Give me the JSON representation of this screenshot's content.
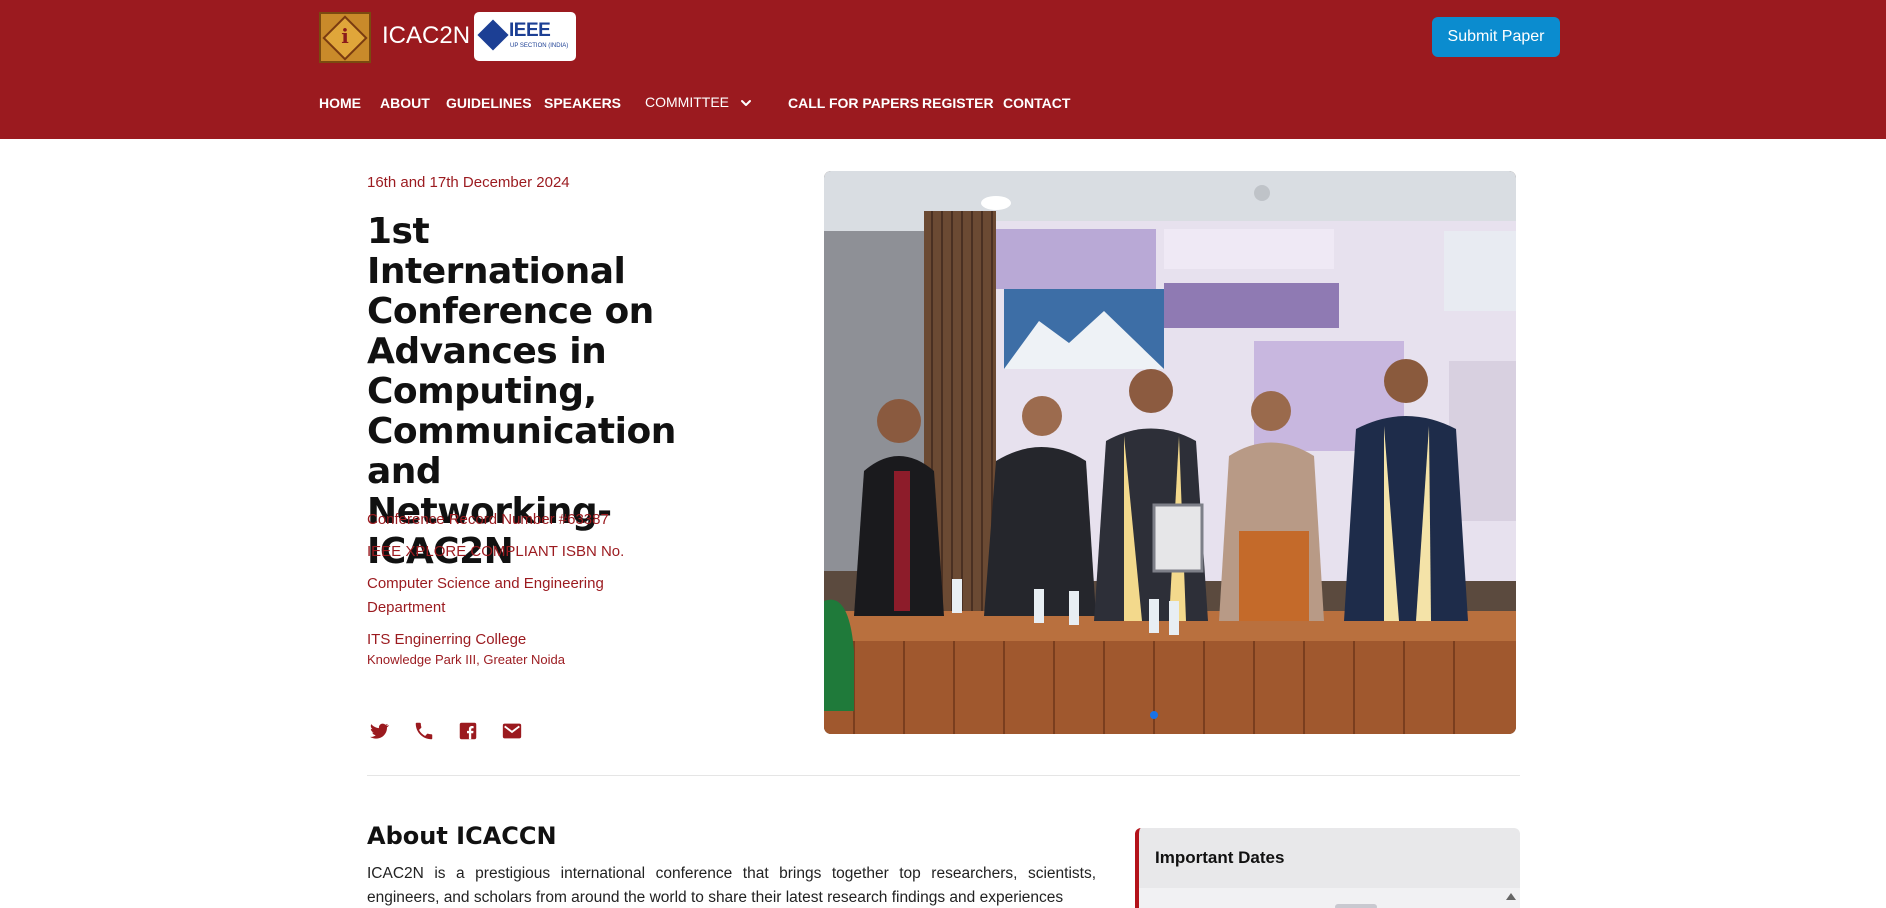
{
  "header": {
    "brand": "ICAC2N",
    "ieee_logo": {
      "text": "IEEE",
      "subtext": "UP SECTION (INDIA)"
    },
    "submit_label": "Submit Paper"
  },
  "nav": {
    "items": [
      {
        "label": "HOME"
      },
      {
        "label": "ABOUT"
      },
      {
        "label": "GUIDELINES"
      },
      {
        "label": "SPEAKERS"
      },
      {
        "label": "COMMITTEE"
      },
      {
        "label": "CALL FOR PAPERS"
      },
      {
        "label": "REGISTER"
      },
      {
        "label": "CONTACT"
      }
    ]
  },
  "hero": {
    "date": "16th and 17th December 2024",
    "title": "1st International Conference on Advances in Computing, Communication and Networking-ICAC2N",
    "record": "Conference Record Number #63387",
    "isbn": "IEEE XPLORE COMPLIANT ISBN No.",
    "department": "Computer Science and Engineering Department",
    "college": "ITS Enginerring College",
    "location": "Knowledge Park III, Greater Noida",
    "social_icons": [
      "twitter-icon",
      "phone-icon",
      "facebook-icon",
      "mail-icon"
    ]
  },
  "about": {
    "title": "About ICACCN",
    "text": "ICAC2N is a prestigious international conference that brings together top researchers, scientists, engineers, and scholars from around the world to share their latest research findings and experiences"
  },
  "important_dates": {
    "title": "Important Dates"
  },
  "colors": {
    "brand_red": "#9b1a1f",
    "accent_blue": "#0b8ccf"
  }
}
